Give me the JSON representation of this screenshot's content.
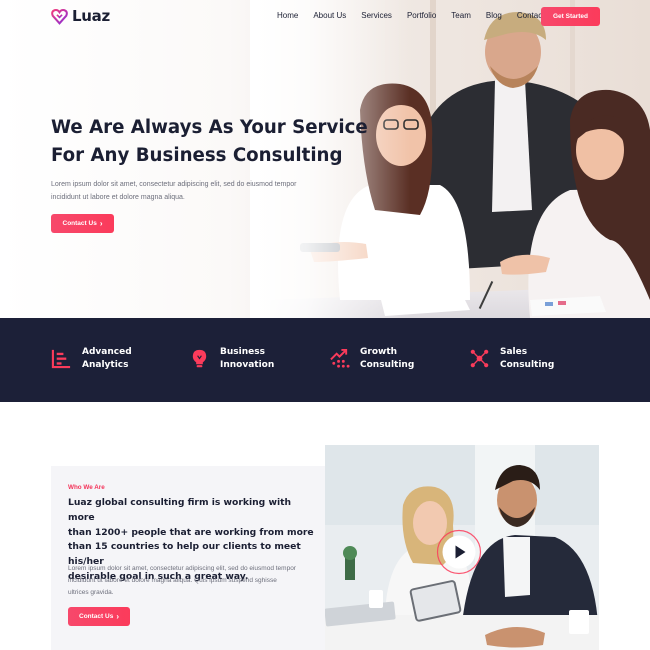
{
  "brand": {
    "name": "Luaz",
    "accent": "#f7486b",
    "dark": "#1c2038"
  },
  "nav": {
    "items": [
      "Home",
      "About Us",
      "Services",
      "Portfolio",
      "Team",
      "Blog",
      "Contact Us"
    ],
    "cta_label": "Get Started"
  },
  "hero": {
    "title_line1": "We Are Always As Your Service",
    "title_line2": "For Any Business Consulting",
    "subtitle_line1": "Lorem ipsum dolor sit amet, consectetur adipiscing elit, sed do eiusmod tempor",
    "subtitle_line2": "incididunt ut labore et dolore magna aliqua.",
    "cta_label": "Contact Us",
    "cta_icon": "chevron-right-icon"
  },
  "services": [
    {
      "line1": "Advanced",
      "line2": "Analytics",
      "icon": "bar-chart-icon"
    },
    {
      "line1": "Business",
      "line2": "Innovation",
      "icon": "lightbulb-icon"
    },
    {
      "line1": "Growth",
      "line2": "Consulting",
      "icon": "growth-arrow-icon"
    },
    {
      "line1": "Sales",
      "line2": "Consulting",
      "icon": "team-network-icon"
    }
  ],
  "about": {
    "eyebrow": "Who We Are",
    "heading_line1": "Luaz global consulting firm is working with more",
    "heading_line2": "than 1200+ people that are working from more",
    "heading_line3": "than 15 countries to help our clients to meet his/her",
    "heading_line4": "desirable goal in such a great way.",
    "text_line1": "Lorem ipsum dolor sit amet, consectetur adipiscing elit, sed do eiusmod tempor",
    "text_line2": "incididunt ut labore et dolore magna aliqua. Quis ipsum suspend sghisse",
    "text_line3": "ultrices gravida.",
    "cta_label": "Contact Us",
    "video_icon": "play-icon"
  }
}
